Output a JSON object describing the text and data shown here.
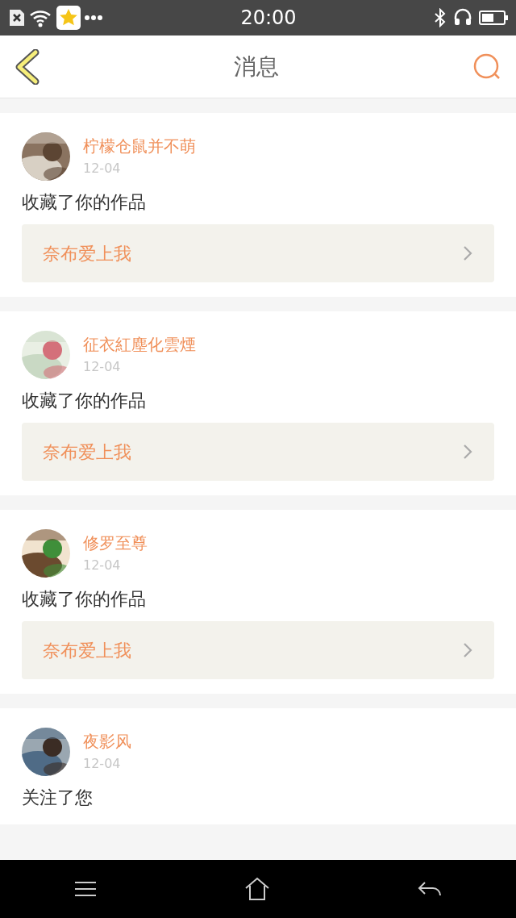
{
  "status_bar": {
    "time": "20:00"
  },
  "header": {
    "title": "消息"
  },
  "messages": [
    {
      "name": "柠檬仓鼠并不萌",
      "date": "12-04",
      "text": "收藏了你的作品",
      "work": "奈布爱上我"
    },
    {
      "name": "征衣紅塵化雲煙",
      "date": "12-04",
      "text": "收藏了你的作品",
      "work": "奈布爱上我"
    },
    {
      "name": "修罗至尊",
      "date": "12-04",
      "text": "收藏了你的作品",
      "work": "奈布爱上我"
    },
    {
      "name": "夜影风",
      "date": "12-04",
      "text": "关注了您"
    }
  ]
}
